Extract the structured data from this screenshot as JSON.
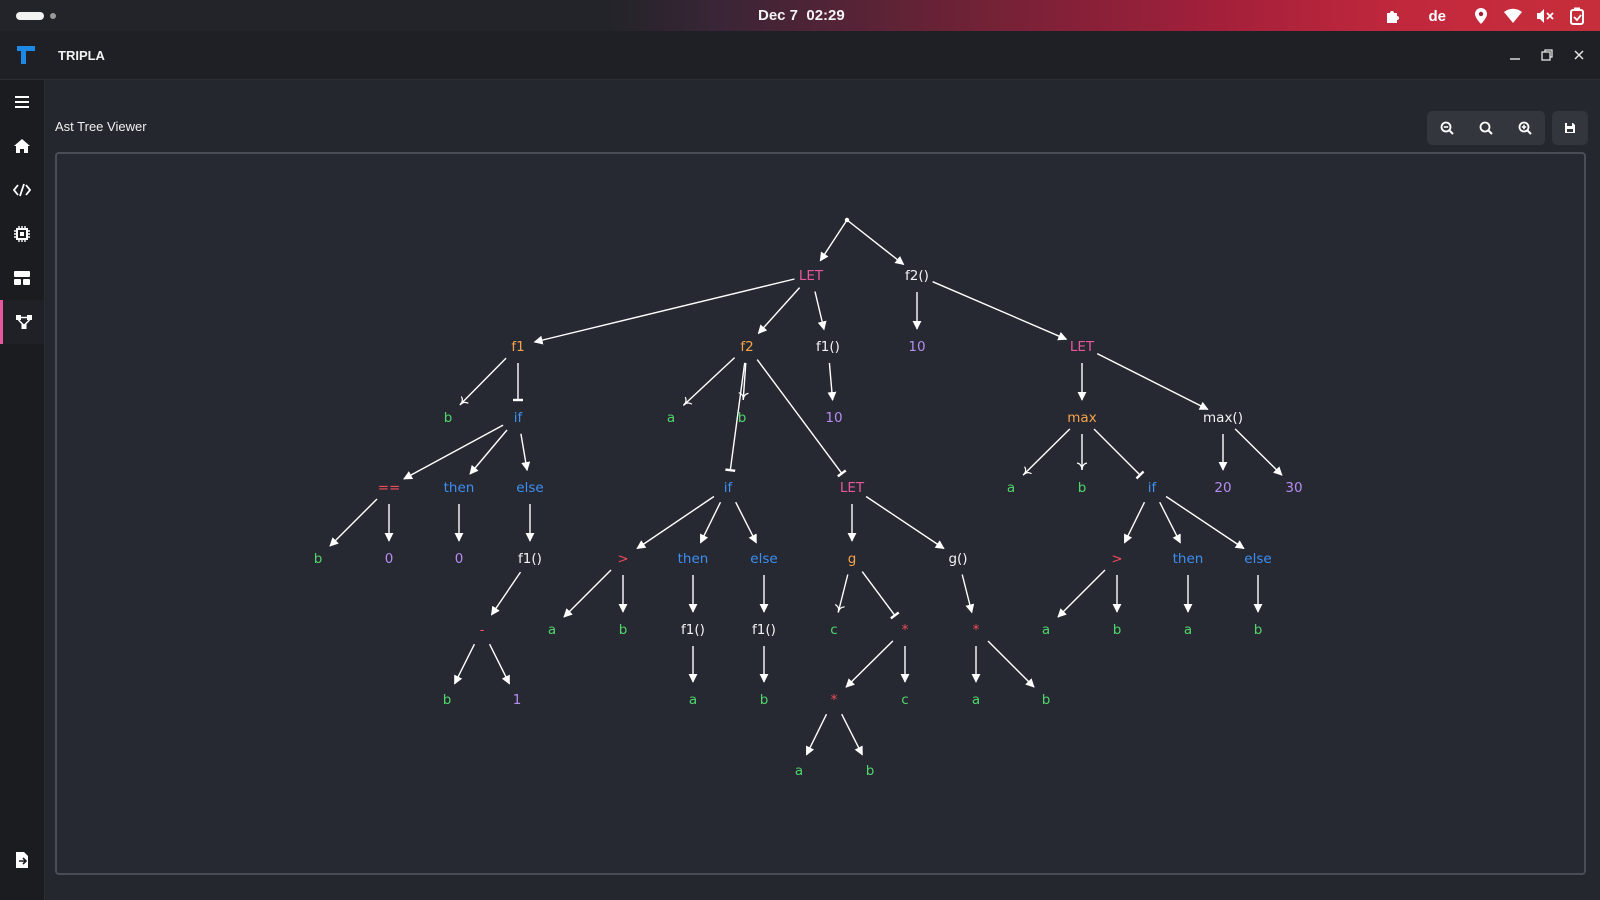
{
  "topbar": {
    "date": "Dec 7",
    "time": "02:29",
    "keyboard_layout": "de",
    "icons": [
      "extension-icon",
      "location-icon",
      "wifi-icon",
      "volume-muted-icon",
      "battery-icon"
    ]
  },
  "window": {
    "title": "TRIPLA",
    "controls": [
      "minimize",
      "restore",
      "close"
    ]
  },
  "sidebar": {
    "items": [
      {
        "name": "menu",
        "icon": "hamburger-icon"
      },
      {
        "name": "home",
        "icon": "home-icon"
      },
      {
        "name": "code",
        "icon": "code-icon"
      },
      {
        "name": "processor",
        "icon": "chip-icon"
      },
      {
        "name": "layout",
        "icon": "layout-icon"
      },
      {
        "name": "ast-tree",
        "icon": "tree-icon",
        "active": true
      }
    ],
    "footer_icon": "file-export-icon"
  },
  "main": {
    "page_title": "Ast Tree Viewer",
    "toolbar": [
      "zoom-out-icon",
      "zoom-reset-icon",
      "zoom-in-icon",
      "save-icon"
    ]
  },
  "colors": {
    "keyword": "#e8579c",
    "function": "#f5a34b",
    "variable": "#4fd66b",
    "number": "#b58cf2",
    "control": "#3d8ff2",
    "operator": "#f04b5a",
    "call": "#f2f2f2"
  },
  "tree": {
    "nodes": [
      {
        "id": "root",
        "label": "",
        "type": "root"
      },
      {
        "id": "let1",
        "label": "LET",
        "type": "keyword"
      },
      {
        "id": "f2call",
        "label": "f2()",
        "type": "call"
      },
      {
        "id": "f1",
        "label": "f1",
        "type": "function"
      },
      {
        "id": "f2",
        "label": "f2",
        "type": "function"
      },
      {
        "id": "f1call_a",
        "label": "f1()",
        "type": "call"
      },
      {
        "id": "n10a",
        "label": "10",
        "type": "number"
      },
      {
        "id": "let2",
        "label": "LET",
        "type": "keyword"
      },
      {
        "id": "f1_b",
        "label": "b",
        "type": "variable"
      },
      {
        "id": "f1_if",
        "label": "if",
        "type": "control"
      },
      {
        "id": "f2_a",
        "label": "a",
        "type": "variable"
      },
      {
        "id": "f2_b",
        "label": "b",
        "type": "variable"
      },
      {
        "id": "n10b",
        "label": "10",
        "type": "number"
      },
      {
        "id": "max",
        "label": "max",
        "type": "function"
      },
      {
        "id": "maxcall",
        "label": "max()",
        "type": "call"
      },
      {
        "id": "eq",
        "label": "==",
        "type": "operator"
      },
      {
        "id": "then1",
        "label": "then",
        "type": "control"
      },
      {
        "id": "else1",
        "label": "else",
        "type": "control"
      },
      {
        "id": "if2",
        "label": "if",
        "type": "control"
      },
      {
        "id": "let3",
        "label": "LET",
        "type": "keyword"
      },
      {
        "id": "max_a",
        "label": "a",
        "type": "variable"
      },
      {
        "id": "max_b",
        "label": "b",
        "type": "variable"
      },
      {
        "id": "if3",
        "label": "if",
        "type": "control"
      },
      {
        "id": "n20",
        "label": "20",
        "type": "number"
      },
      {
        "id": "n30",
        "label": "30",
        "type": "number"
      },
      {
        "id": "eq_b",
        "label": "b",
        "type": "variable"
      },
      {
        "id": "eq_0",
        "label": "0",
        "type": "number"
      },
      {
        "id": "then1_0",
        "label": "0",
        "type": "number"
      },
      {
        "id": "else1_f1",
        "label": "f1()",
        "type": "call"
      },
      {
        "id": "gt2",
        "label": ">",
        "type": "operator"
      },
      {
        "id": "then2",
        "label": "then",
        "type": "control"
      },
      {
        "id": "else2",
        "label": "else",
        "type": "control"
      },
      {
        "id": "g",
        "label": "g",
        "type": "function"
      },
      {
        "id": "gcall",
        "label": "g()",
        "type": "call"
      },
      {
        "id": "gt3",
        "label": ">",
        "type": "operator"
      },
      {
        "id": "then3",
        "label": "then",
        "type": "control"
      },
      {
        "id": "else3",
        "label": "else",
        "type": "control"
      },
      {
        "id": "minus",
        "label": "-",
        "type": "operator"
      },
      {
        "id": "gt2_a",
        "label": "a",
        "type": "variable"
      },
      {
        "id": "gt2_b",
        "label": "b",
        "type": "variable"
      },
      {
        "id": "then2_f1",
        "label": "f1()",
        "type": "call"
      },
      {
        "id": "else2_f1",
        "label": "f1()",
        "type": "call"
      },
      {
        "id": "g_c",
        "label": "c",
        "type": "variable"
      },
      {
        "id": "mul1",
        "label": "*",
        "type": "operator"
      },
      {
        "id": "mul3",
        "label": "*",
        "type": "operator"
      },
      {
        "id": "gt3_a",
        "label": "a",
        "type": "variable"
      },
      {
        "id": "gt3_b",
        "label": "b",
        "type": "variable"
      },
      {
        "id": "then3_a",
        "label": "a",
        "type": "variable"
      },
      {
        "id": "else3_b",
        "label": "b",
        "type": "variable"
      },
      {
        "id": "minus_b",
        "label": "b",
        "type": "variable"
      },
      {
        "id": "minus_1",
        "label": "1",
        "type": "number"
      },
      {
        "id": "then2_a",
        "label": "a",
        "type": "variable"
      },
      {
        "id": "else2_b",
        "label": "b",
        "type": "variable"
      },
      {
        "id": "mul2",
        "label": "*",
        "type": "operator"
      },
      {
        "id": "mul1_c",
        "label": "c",
        "type": "variable"
      },
      {
        "id": "mul3_a",
        "label": "a",
        "type": "variable"
      },
      {
        "id": "mul3_b",
        "label": "b",
        "type": "variable"
      },
      {
        "id": "mul2_a",
        "label": "a",
        "type": "variable"
      },
      {
        "id": "mul2_b",
        "label": "b",
        "type": "variable"
      }
    ],
    "edges": [
      {
        "from": "root",
        "to": "let1",
        "kind": "arrow"
      },
      {
        "from": "root",
        "to": "f2call",
        "kind": "arrow"
      },
      {
        "from": "let1",
        "to": "f1",
        "kind": "arrow"
      },
      {
        "from": "let1",
        "to": "f2",
        "kind": "arrow"
      },
      {
        "from": "let1",
        "to": "f1call_a",
        "kind": "arrow"
      },
      {
        "from": "f2call",
        "to": "n10a",
        "kind": "arrow"
      },
      {
        "from": "f2call",
        "to": "let2",
        "kind": "arrow"
      },
      {
        "from": "f1",
        "to": "f1_b",
        "kind": "param"
      },
      {
        "from": "f1",
        "to": "f1_if",
        "kind": "body"
      },
      {
        "from": "f2",
        "to": "f2_a",
        "kind": "param"
      },
      {
        "from": "f2",
        "to": "f2_b",
        "kind": "param"
      },
      {
        "from": "f2",
        "to": "if2",
        "kind": "body"
      },
      {
        "from": "f2",
        "to": "let3",
        "kind": "body"
      },
      {
        "from": "f1call_a",
        "to": "n10b",
        "kind": "arrow"
      },
      {
        "from": "let2",
        "to": "max",
        "kind": "arrow"
      },
      {
        "from": "let2",
        "to": "maxcall",
        "kind": "arrow"
      },
      {
        "from": "f1_if",
        "to": "eq",
        "kind": "arrow"
      },
      {
        "from": "f1_if",
        "to": "then1",
        "kind": "arrow"
      },
      {
        "from": "f1_if",
        "to": "else1",
        "kind": "arrow"
      },
      {
        "from": "max",
        "to": "max_a",
        "kind": "param"
      },
      {
        "from": "max",
        "to": "max_b",
        "kind": "param"
      },
      {
        "from": "max",
        "to": "if3",
        "kind": "body"
      },
      {
        "from": "maxcall",
        "to": "n20",
        "kind": "arrow"
      },
      {
        "from": "maxcall",
        "to": "n30",
        "kind": "arrow"
      },
      {
        "from": "eq",
        "to": "eq_b",
        "kind": "arrow"
      },
      {
        "from": "eq",
        "to": "eq_0",
        "kind": "arrow"
      },
      {
        "from": "then1",
        "to": "then1_0",
        "kind": "arrow"
      },
      {
        "from": "else1",
        "to": "else1_f1",
        "kind": "arrow"
      },
      {
        "from": "if2",
        "to": "gt2",
        "kind": "arrow"
      },
      {
        "from": "if2",
        "to": "then2",
        "kind": "arrow"
      },
      {
        "from": "if2",
        "to": "else2",
        "kind": "arrow"
      },
      {
        "from": "let3",
        "to": "g",
        "kind": "arrow"
      },
      {
        "from": "let3",
        "to": "gcall",
        "kind": "arrow"
      },
      {
        "from": "if3",
        "to": "gt3",
        "kind": "arrow"
      },
      {
        "from": "if3",
        "to": "then3",
        "kind": "arrow"
      },
      {
        "from": "if3",
        "to": "else3",
        "kind": "arrow"
      },
      {
        "from": "else1_f1",
        "to": "minus",
        "kind": "arrow"
      },
      {
        "from": "gt2",
        "to": "gt2_a",
        "kind": "arrow"
      },
      {
        "from": "gt2",
        "to": "gt2_b",
        "kind": "arrow"
      },
      {
        "from": "then2",
        "to": "then2_f1",
        "kind": "arrow"
      },
      {
        "from": "else2",
        "to": "else2_f1",
        "kind": "arrow"
      },
      {
        "from": "g",
        "to": "g_c",
        "kind": "param"
      },
      {
        "from": "g",
        "to": "mul1",
        "kind": "body"
      },
      {
        "from": "gcall",
        "to": "mul3",
        "kind": "arrow"
      },
      {
        "from": "gt3",
        "to": "gt3_a",
        "kind": "arrow"
      },
      {
        "from": "gt3",
        "to": "gt3_b",
        "kind": "arrow"
      },
      {
        "from": "then3",
        "to": "then3_a",
        "kind": "arrow"
      },
      {
        "from": "else3",
        "to": "else3_b",
        "kind": "arrow"
      },
      {
        "from": "minus",
        "to": "minus_b",
        "kind": "arrow"
      },
      {
        "from": "minus",
        "to": "minus_1",
        "kind": "arrow"
      },
      {
        "from": "then2_f1",
        "to": "then2_a",
        "kind": "arrow"
      },
      {
        "from": "else2_f1",
        "to": "else2_b",
        "kind": "arrow"
      },
      {
        "from": "mul1",
        "to": "mul2",
        "kind": "arrow"
      },
      {
        "from": "mul1",
        "to": "mul1_c",
        "kind": "arrow"
      },
      {
        "from": "mul3",
        "to": "mul3_a",
        "kind": "arrow"
      },
      {
        "from": "mul3",
        "to": "mul3_b",
        "kind": "arrow"
      },
      {
        "from": "mul2",
        "to": "mul2_a",
        "kind": "arrow"
      },
      {
        "from": "mul2",
        "to": "mul2_b",
        "kind": "arrow"
      }
    ]
  }
}
